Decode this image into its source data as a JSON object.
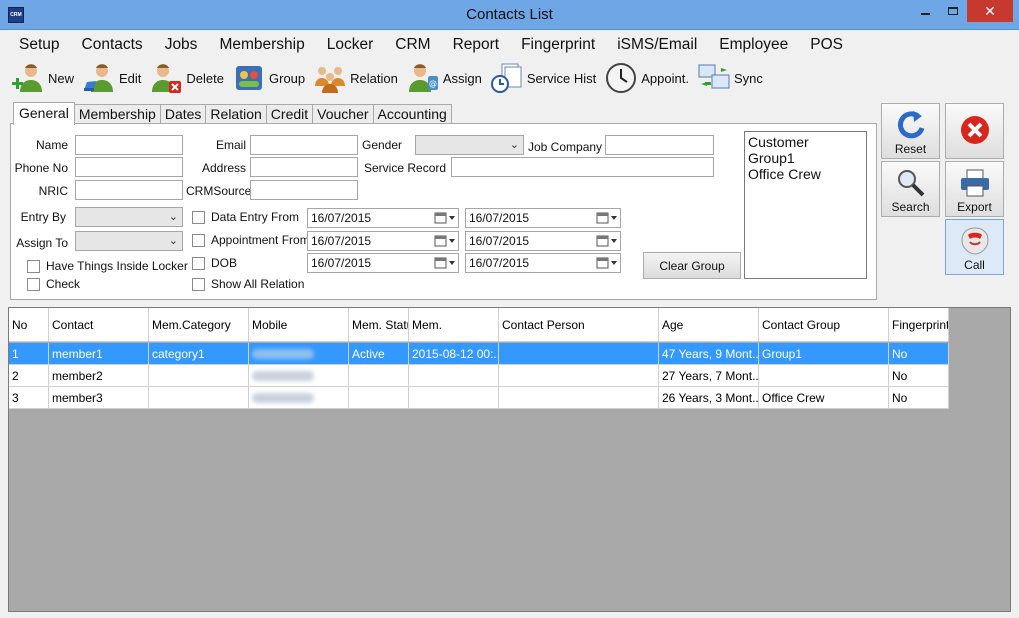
{
  "window": {
    "title": "Contacts List",
    "app_icon_text": "CRM",
    "close_glyph": "✕"
  },
  "menu": [
    "Setup",
    "Contacts",
    "Jobs",
    "Membership",
    "Locker",
    "CRM",
    "Report",
    "Fingerprint",
    "iSMS/Email",
    "Employee",
    "POS"
  ],
  "toolbar": [
    {
      "label": "New",
      "icon": "person-add-icon"
    },
    {
      "label": "Edit",
      "icon": "person-edit-icon"
    },
    {
      "label": "Delete",
      "icon": "person-delete-icon"
    },
    {
      "label": "Group",
      "icon": "group-icon"
    },
    {
      "label": "Relation",
      "icon": "relation-icon"
    },
    {
      "label": "Assign",
      "icon": "assign-icon"
    },
    {
      "label": "Service Hist",
      "icon": "service-history-icon"
    },
    {
      "label": "Appoint.",
      "icon": "clock-icon"
    },
    {
      "label": "Sync",
      "icon": "sync-icon"
    }
  ],
  "tabs": [
    "General",
    "Membership",
    "Dates",
    "Relation",
    "Credit",
    "Voucher",
    "Accounting"
  ],
  "form": {
    "name_label": "Name",
    "phone_label": "Phone No",
    "nric_label": "NRIC",
    "email_label": "Email",
    "address_label": "Address",
    "crmsource_label": "CRMSource",
    "gender_label": "Gender",
    "job_company_label": "Job Company",
    "service_record_label": "Service Record",
    "entry_by_label": "Entry By",
    "assign_to_label": "Assign To",
    "locker_check_label": "Have Things Inside Locker",
    "check_label": "Check",
    "data_entry_from_label": "Data Entry From",
    "appointment_from_label": "Appointment From",
    "dob_label": "DOB",
    "show_all_relation_label": "Show All Relation",
    "date_value": "16/07/2015",
    "clear_group_label": "Clear Group"
  },
  "groups": [
    "Customer",
    "Group1",
    "Office Crew"
  ],
  "side_buttons": {
    "reset": "Reset",
    "search": "Search",
    "export": "Export",
    "call": "Call"
  },
  "colors": {
    "selection": "#3399ff",
    "titlebar": "#6fa7e6",
    "close": "#c7392f"
  },
  "table": {
    "columns": [
      "No",
      "Contact",
      "Mem.Category",
      "Mobile",
      "Mem.\nStatus",
      "Mem.",
      "Contact Person",
      "Age",
      "Contact Group",
      "Fingerprint"
    ],
    "rows": [
      [
        "1",
        "member1",
        "category1",
        "",
        "Active",
        "2015-08-12 00:...",
        "",
        "47 Years, 9 Mont...",
        "Group1",
        "No"
      ],
      [
        "2",
        "member2",
        "",
        "",
        "",
        "",
        "",
        "27 Years, 7 Mont...",
        "",
        "No"
      ],
      [
        "3",
        "member3",
        "",
        "",
        "",
        "",
        "",
        "26 Years, 3 Mont...",
        "Office Crew",
        "No"
      ]
    ],
    "selected_row": 0
  }
}
